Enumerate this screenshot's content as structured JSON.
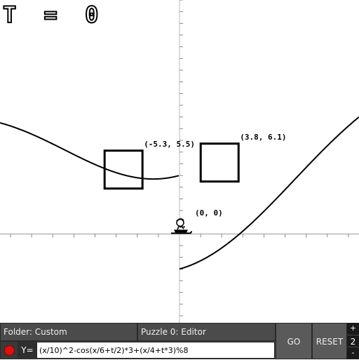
{
  "hud": {
    "time_label": "T = 0"
  },
  "graph": {
    "x_range": [
      -17,
      17
    ],
    "y_range": [
      -7.6,
      20
    ],
    "tick_spacing": 1,
    "axis_color": "#888888",
    "curve_color": "#000000",
    "curve_expression": "(x/10)^2-cos(x/6+t/2)*3+(x/4+t*3)%8",
    "targets": [
      {
        "x": -5.3,
        "y": 5.5,
        "label": "(-5.3, 5.5)"
      },
      {
        "x": 3.8,
        "y": 6.1,
        "label": "(3.8, 6.1)"
      }
    ],
    "player": {
      "x": 0,
      "y": 0,
      "label": "(0, 0)"
    }
  },
  "toolbar": {
    "folder_label": "Folder: Custom",
    "puzzle_label": "Puzzle 0: Editor",
    "y_prefix": "Y=",
    "expression_value": "(x/10)^2-cos(x/6+t/2)*3+(x/4+t*3)%8",
    "go_label": "GO",
    "reset_label": "RESET",
    "plus_label": "+",
    "speed_value": "2",
    "minus_label": "-",
    "record_color": "#e01010"
  }
}
